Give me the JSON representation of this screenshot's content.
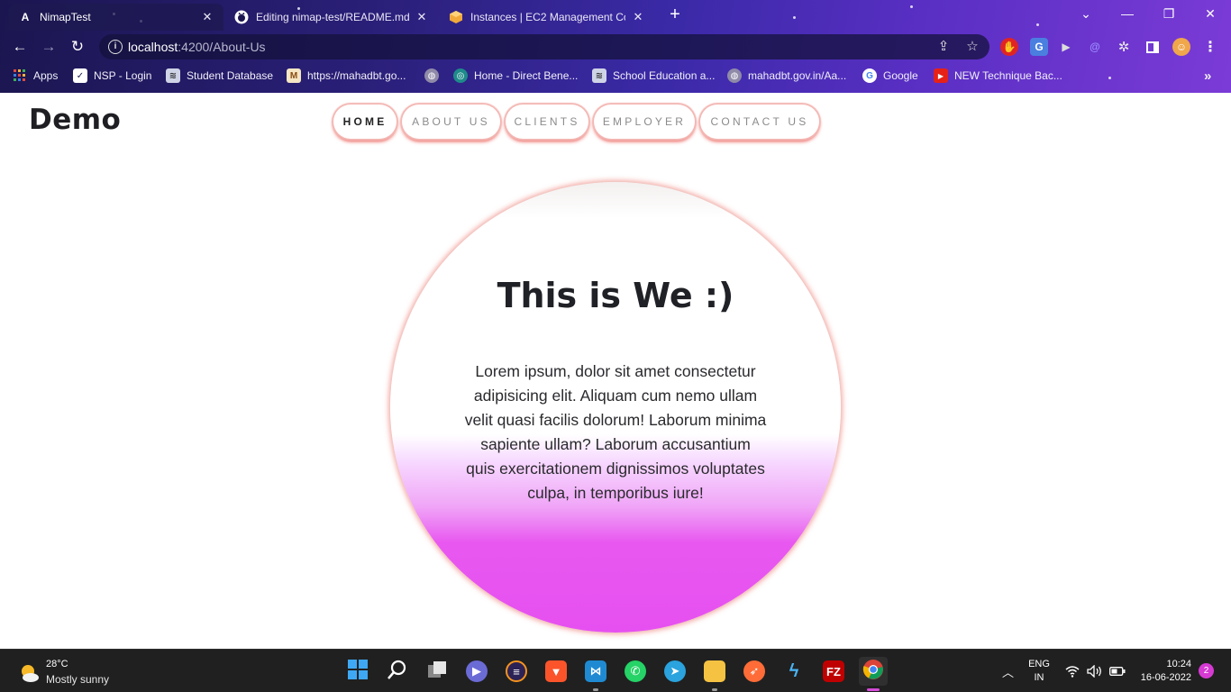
{
  "browser": {
    "tabs": [
      {
        "title": "NimapTest",
        "icon": "angular-icon",
        "active": true
      },
      {
        "title": "Editing nimap-test/README.md",
        "icon": "github-icon",
        "active": false
      },
      {
        "title": "Instances | EC2 Management Con",
        "icon": "aws-icon",
        "active": false
      }
    ],
    "url_host": "localhost",
    "url_path": ":4200/About-Us",
    "bookmarks": [
      {
        "label": "Apps",
        "icon": "apps-grid-icon"
      },
      {
        "label": "NSP - Login",
        "icon": "nsp-icon"
      },
      {
        "label": "Student Database",
        "icon": "database-icon"
      },
      {
        "label": "https://mahadbt.go...",
        "icon": "mahadbt-icon"
      },
      {
        "label": "",
        "icon": "globe-icon"
      },
      {
        "label": "Home - Direct Bene...",
        "icon": "dbt-icon"
      },
      {
        "label": "School Education a...",
        "icon": "school-icon"
      },
      {
        "label": "mahadbt.gov.in/Aa...",
        "icon": "globe-icon"
      },
      {
        "label": "Google",
        "icon": "google-icon"
      },
      {
        "label": "NEW Technique Bac...",
        "icon": "youtube-icon"
      }
    ]
  },
  "page": {
    "brand": "Demo",
    "nav": [
      {
        "label": "HOME",
        "active": true
      },
      {
        "label": "ABOUT US",
        "active": false
      },
      {
        "label": "CLIENTS",
        "active": false
      },
      {
        "label": "EMPLOYER",
        "active": false
      },
      {
        "label": "CONTACT US",
        "active": false
      }
    ],
    "hero": {
      "title": "This is We :)",
      "text": "Lorem ipsum, dolor sit amet consectetur adipisicing elit. Aliquam cum nemo ullam velit quasi facilis dolorum! Laborum minima sapiente ullam? Laborum accusantium quis exercitationem dignissimos voluptates culpa, in temporibus iure!"
    },
    "colors": {
      "accent_shadow": "#e9534c",
      "gradient_bottom": "#e650f0"
    }
  },
  "taskbar": {
    "weather_temp": "28°C",
    "weather_desc": "Mostly sunny",
    "language": "ENG",
    "region": "IN",
    "time": "10:24",
    "date": "16-06-2022",
    "notifications": "2"
  }
}
